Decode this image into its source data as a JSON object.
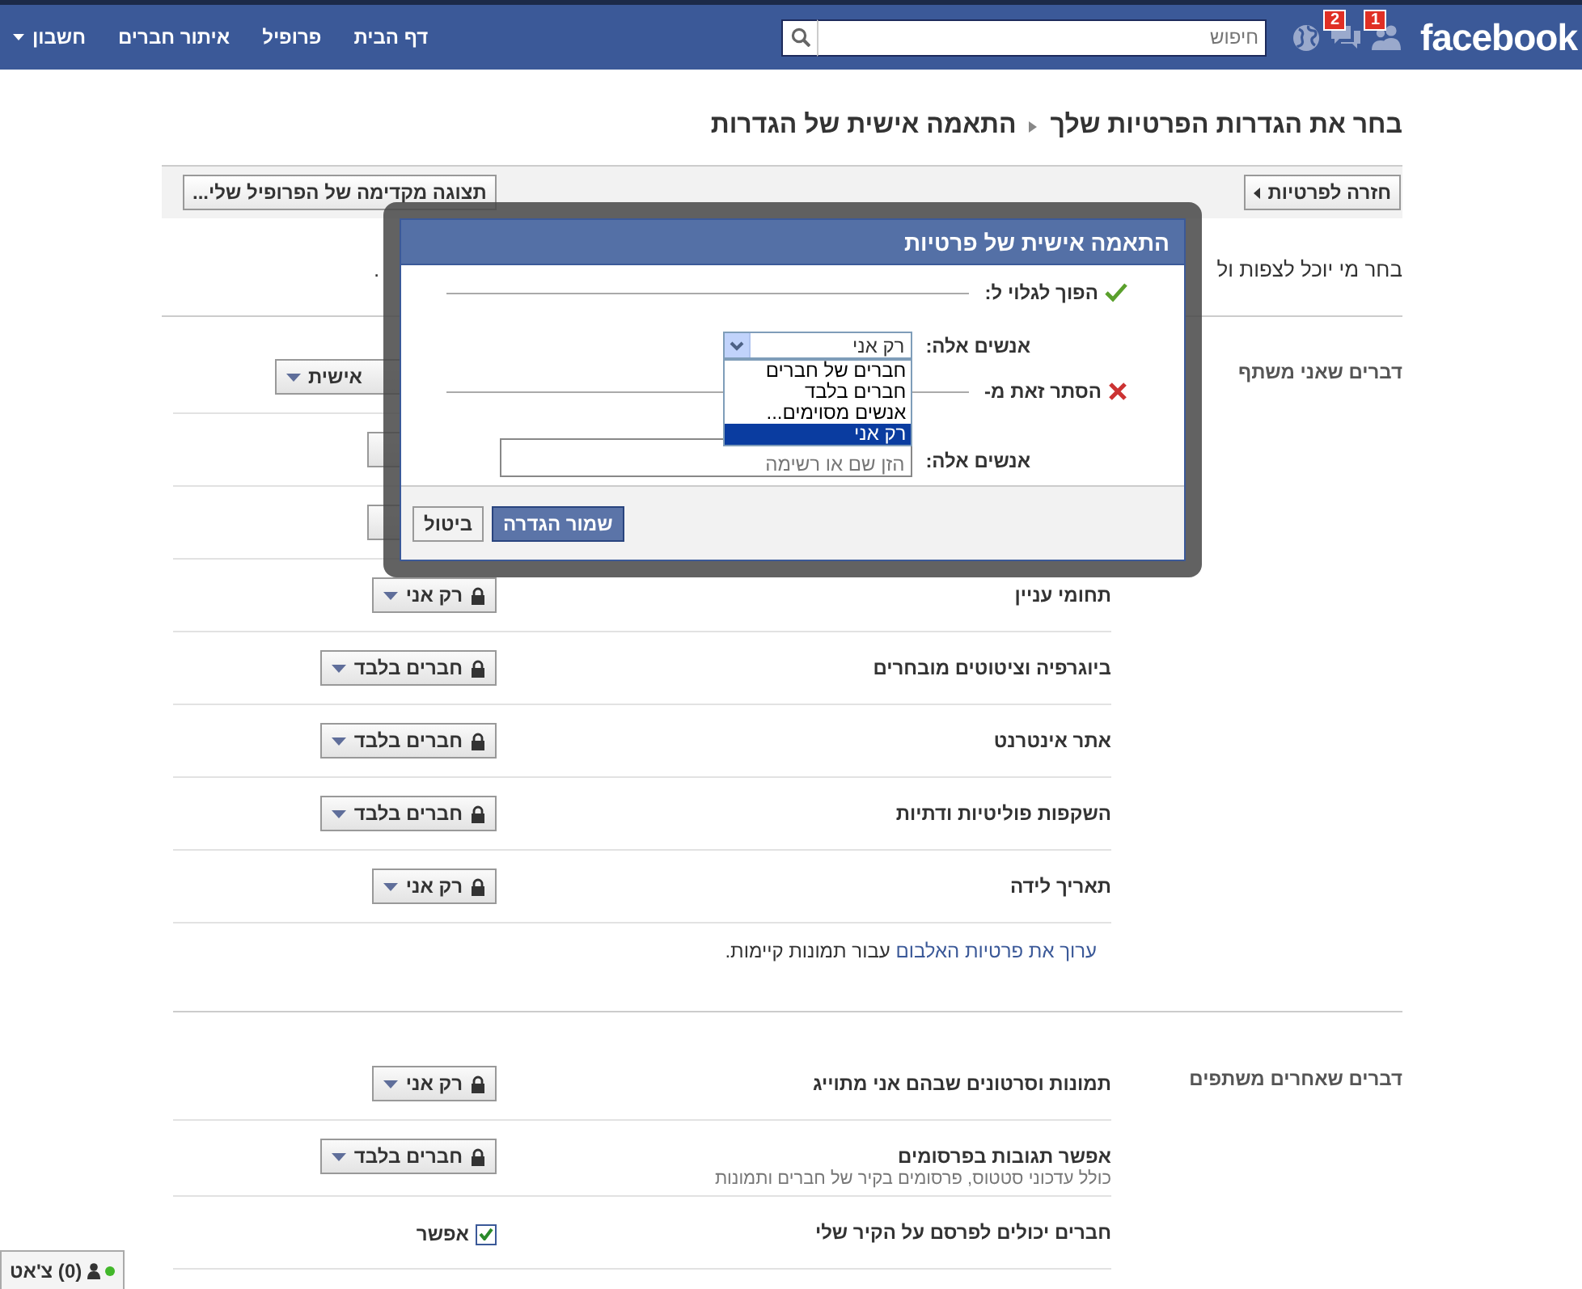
{
  "top_bar": {
    "logo": "facebook",
    "notifications": [
      {
        "kind": "friends",
        "count": "1"
      },
      {
        "kind": "messages",
        "count": "2"
      },
      {
        "kind": "globe"
      }
    ],
    "search": {
      "placeholder": "חיפוש"
    },
    "nav": [
      {
        "label": "דף הבית"
      },
      {
        "label": "פרופיל"
      },
      {
        "label": "איתור חברים"
      },
      {
        "label": "חשבון",
        "kind": "menu"
      }
    ]
  },
  "breadcrumb": [
    "בחר את הגדרות הפרטיות שלך",
    "התאמה אישית של הגדרות"
  ],
  "toolbar": {
    "back_button": "חזרה לפרטיות",
    "preview_button": "תצוגה מקדימה של הפרופיל שלי..."
  },
  "intro": {
    "text": "בחר מי יוכל לצפות ול",
    "tail": "."
  },
  "sections": [
    {
      "title": "דברים שאני משתף",
      "rows": [
        {
          "kind": "partial",
          "value": "אישית"
        },
        {
          "kind": "covered"
        },
        {
          "kind": "covered"
        },
        {
          "kind": "privacy",
          "label": "תחומי עניין",
          "value": "רק אני"
        },
        {
          "kind": "privacy",
          "label": "ביוגרפיה וציטוטים מובחרים",
          "value": "חברים בלבד"
        },
        {
          "kind": "privacy",
          "label": "אתר אינטרנט",
          "value": "חברים בלבד"
        },
        {
          "kind": "privacy",
          "label": "השקפות פוליטיות ודתיות",
          "value": "חברים בלבד"
        },
        {
          "kind": "privacy",
          "label": "תאריך לידה",
          "value": "רק אני"
        }
      ],
      "footer": {
        "link": "ערוך את פרטיות האלבום",
        "text": "עבור תמונות קיימות."
      }
    },
    {
      "title": "דברים שאחרים משתפים",
      "rows": [
        {
          "kind": "privacy",
          "label": "תמונות וסרטונים שבהם אני מתוייג",
          "value": "רק אני"
        },
        {
          "kind": "privacy",
          "label": "אפשר תגובות בפרסומים",
          "sublabel": "כולל עדכוני סטטוס, פרסומים בקיר של חברים ותמונות",
          "value": "חברים בלבד"
        },
        {
          "kind": "checkbox",
          "label": "חברים יכולים לפרסם על הקיר שלי",
          "option": "אפשר",
          "checked": true
        }
      ]
    }
  ],
  "dialog": {
    "title": "התאמה אישית של פרטיות",
    "groups": [
      {
        "kind": "show",
        "heading": "הפוך לגלוי ל:",
        "field_label": "אנשים אלה:",
        "value": "רק אני"
      },
      {
        "kind": "hide",
        "heading": "הסתר זאת מ-",
        "field_label": "אנשים אלה:",
        "placeholder": "הזן שם או רשימה"
      }
    ],
    "dropdown": {
      "options": [
        {
          "label": "חברים של חברים",
          "selected": false
        },
        {
          "label": "חברים בלבד",
          "selected": false
        },
        {
          "label": "אנשים מסוימים...",
          "selected": false
        },
        {
          "label": "רק אני",
          "selected": true
        }
      ]
    },
    "buttons": [
      {
        "label": "שמור הגדרה",
        "kind": "primary"
      },
      {
        "label": "ביטול",
        "kind": "secondary"
      }
    ]
  },
  "chat": {
    "label": "(0) צ'אט",
    "online": true
  }
}
